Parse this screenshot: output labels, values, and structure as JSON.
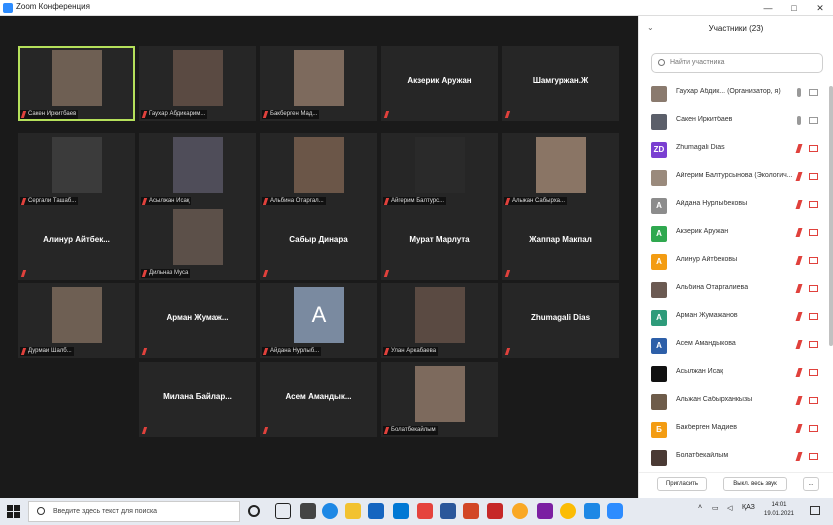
{
  "window": {
    "title": "Zoom Конференция",
    "minimize": "—",
    "maximize": "□",
    "close": "✕"
  },
  "tiles": [
    {
      "type": "video",
      "label": "Сакен Иркитбаев",
      "active": true
    },
    {
      "type": "video",
      "label": "Гаухар Абдикарим..."
    },
    {
      "type": "video",
      "label": "Бакберген Мад..."
    },
    {
      "type": "name",
      "name": "Акзерик Аружан"
    },
    {
      "type": "name",
      "name": "Шамгуржан.Ж"
    },
    {
      "type": "video",
      "label": "Сергали Ташаб..."
    },
    {
      "type": "video",
      "label": "Асылжан Исақ"
    },
    {
      "type": "video",
      "label": "Альбина Отаргал..."
    },
    {
      "type": "video",
      "label": "Айгерим Балтурс..."
    },
    {
      "type": "video",
      "label": "Альжан Сабырха..."
    },
    {
      "type": "name",
      "name": "Алинур Айтбек..."
    },
    {
      "type": "video",
      "label": "Дильназ Муса"
    },
    {
      "type": "name",
      "name": "Сабыр Динара"
    },
    {
      "type": "name",
      "name": "Мурат Марлута"
    },
    {
      "type": "name",
      "name": "Жаппар Макпал"
    },
    {
      "type": "video",
      "label": "Дурмаи Шалб..."
    },
    {
      "type": "name",
      "name": "Арман Жумаж..."
    },
    {
      "type": "avatar",
      "letter": "A",
      "label": "Айдана Нурлыб..."
    },
    {
      "type": "video",
      "label": "Улан Аркабаева"
    },
    {
      "type": "name",
      "name": "Zhumagali Dias"
    },
    {
      "type": "name",
      "name": "Милана Байлар..."
    },
    {
      "type": "name",
      "name": "Асем Амандык..."
    },
    {
      "type": "video",
      "label": "Болатбекайлым"
    }
  ],
  "panel": {
    "title": "Участники (23)",
    "search_placeholder": "Найти участника",
    "invite": "Пригласить",
    "mute_all": "Выкл. весь звук",
    "more": "..."
  },
  "participants": [
    {
      "name": "Гаухар Абдик... (Организатор, я)",
      "avatar": "",
      "color": "#8a7a6e",
      "on": true
    },
    {
      "name": "Сакен Иркитбаев",
      "avatar": "",
      "color": "#5b5f6a",
      "on": true
    },
    {
      "name": "Zhumagali Dias",
      "avatar": "ZD",
      "color": "#7a3fd1",
      "on": false
    },
    {
      "name": "Айгерим Балтурсынова (Экологич...",
      "avatar": "",
      "color": "#9a8a7c",
      "on": false
    },
    {
      "name": "Айдана Нурлыбековы",
      "avatar": "A",
      "color": "#8c8c8c",
      "on": false
    },
    {
      "name": "Акзерик Аружан",
      "avatar": "A",
      "color": "#2fa84f",
      "on": false
    },
    {
      "name": "Алинур Айтбековы",
      "avatar": "A",
      "color": "#f39c12",
      "on": false
    },
    {
      "name": "Альбина Отаргалиева",
      "avatar": "",
      "color": "#6b5a52",
      "on": false
    },
    {
      "name": "Арман Жумажанов",
      "avatar": "A",
      "color": "#2e9b7a",
      "on": false
    },
    {
      "name": "Асем Амандыкова",
      "avatar": "A",
      "color": "#2d5fa8",
      "on": false
    },
    {
      "name": "Асылжан Исақ",
      "avatar": "",
      "color": "#111111",
      "on": false
    },
    {
      "name": "Альжан Сабырханкызы",
      "avatar": "",
      "color": "#6e5c4a",
      "on": false
    },
    {
      "name": "Бакберген Мадиев",
      "avatar": "Б",
      "color": "#f39c12",
      "on": false
    },
    {
      "name": "Болатбекайлым",
      "avatar": "",
      "color": "#4a3a34",
      "on": false
    }
  ],
  "taskbar": {
    "search_placeholder": "Введите здесь текст для поиска",
    "lang": "ҚАЗ",
    "time": "14:01",
    "date": "19.01.2021"
  }
}
